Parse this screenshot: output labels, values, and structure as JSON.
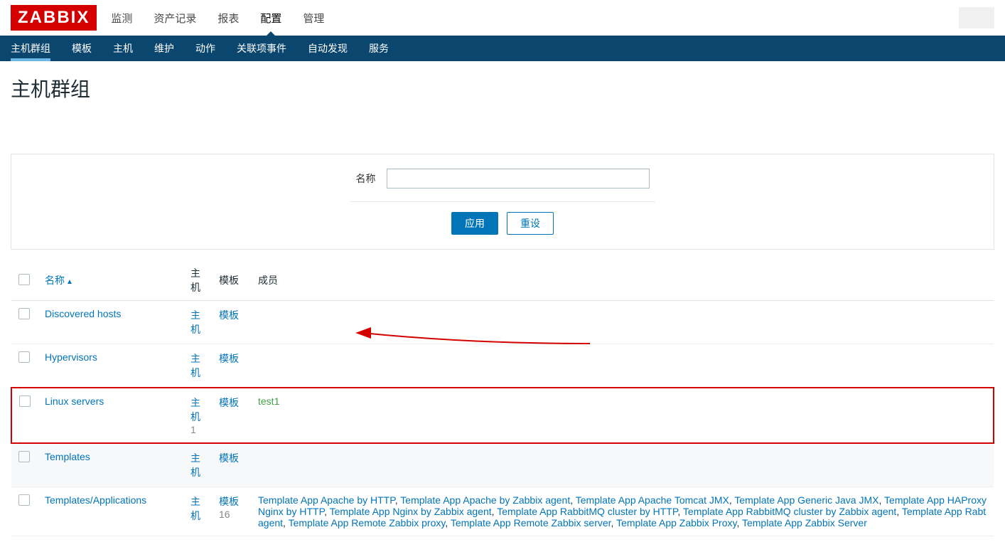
{
  "logo": "ZABBIX",
  "topnav": {
    "items": [
      {
        "label": "监测"
      },
      {
        "label": "资产记录"
      },
      {
        "label": "报表"
      },
      {
        "label": "配置",
        "active": true
      },
      {
        "label": "管理"
      }
    ]
  },
  "subnav": {
    "items": [
      {
        "label": "主机群组",
        "active": true
      },
      {
        "label": "模板"
      },
      {
        "label": "主机"
      },
      {
        "label": "维护"
      },
      {
        "label": "动作"
      },
      {
        "label": "关联项事件"
      },
      {
        "label": "自动发现"
      },
      {
        "label": "服务"
      }
    ]
  },
  "page_title": "主机群组",
  "filter": {
    "name_label": "名称",
    "name_value": "",
    "apply_label": "应用",
    "reset_label": "重设"
  },
  "columns": {
    "name": "名称",
    "host": "主机",
    "template": "模板",
    "members": "成员",
    "sort_indicator": "▲"
  },
  "rows": [
    {
      "name": "Discovered hosts",
      "host_link": "主机",
      "tpl_link": "模板",
      "members": []
    },
    {
      "name": "Hypervisors",
      "host_link": "主机",
      "tpl_link": "模板",
      "members": []
    },
    {
      "name": "Linux servers",
      "host_link": "主机",
      "host_count": "1",
      "tpl_link": "模板",
      "members": [
        {
          "text": "test1",
          "green": true
        }
      ],
      "highlighted": true
    },
    {
      "name": "Templates",
      "host_link": "主机",
      "tpl_link": "模板",
      "members": [],
      "alt": true
    },
    {
      "name": "Templates/Applications",
      "host_link": "主机",
      "tpl_link": "模板",
      "tpl_count": "16",
      "members_text": "Template App Apache by HTTP, Template App Apache by Zabbix agent, Template App Apache Tomcat JMX, Template App Generic Java JMX, Template App HAProxy Nginx by HTTP, Template App Nginx by Zabbix agent, Template App RabbitMQ cluster by HTTP, Template App RabbitMQ cluster by Zabbix agent, Template App Rabt agent, Template App Remote Zabbix proxy, Template App Remote Zabbix server, Template App Zabbix Proxy, Template App Zabbix Server"
    }
  ]
}
